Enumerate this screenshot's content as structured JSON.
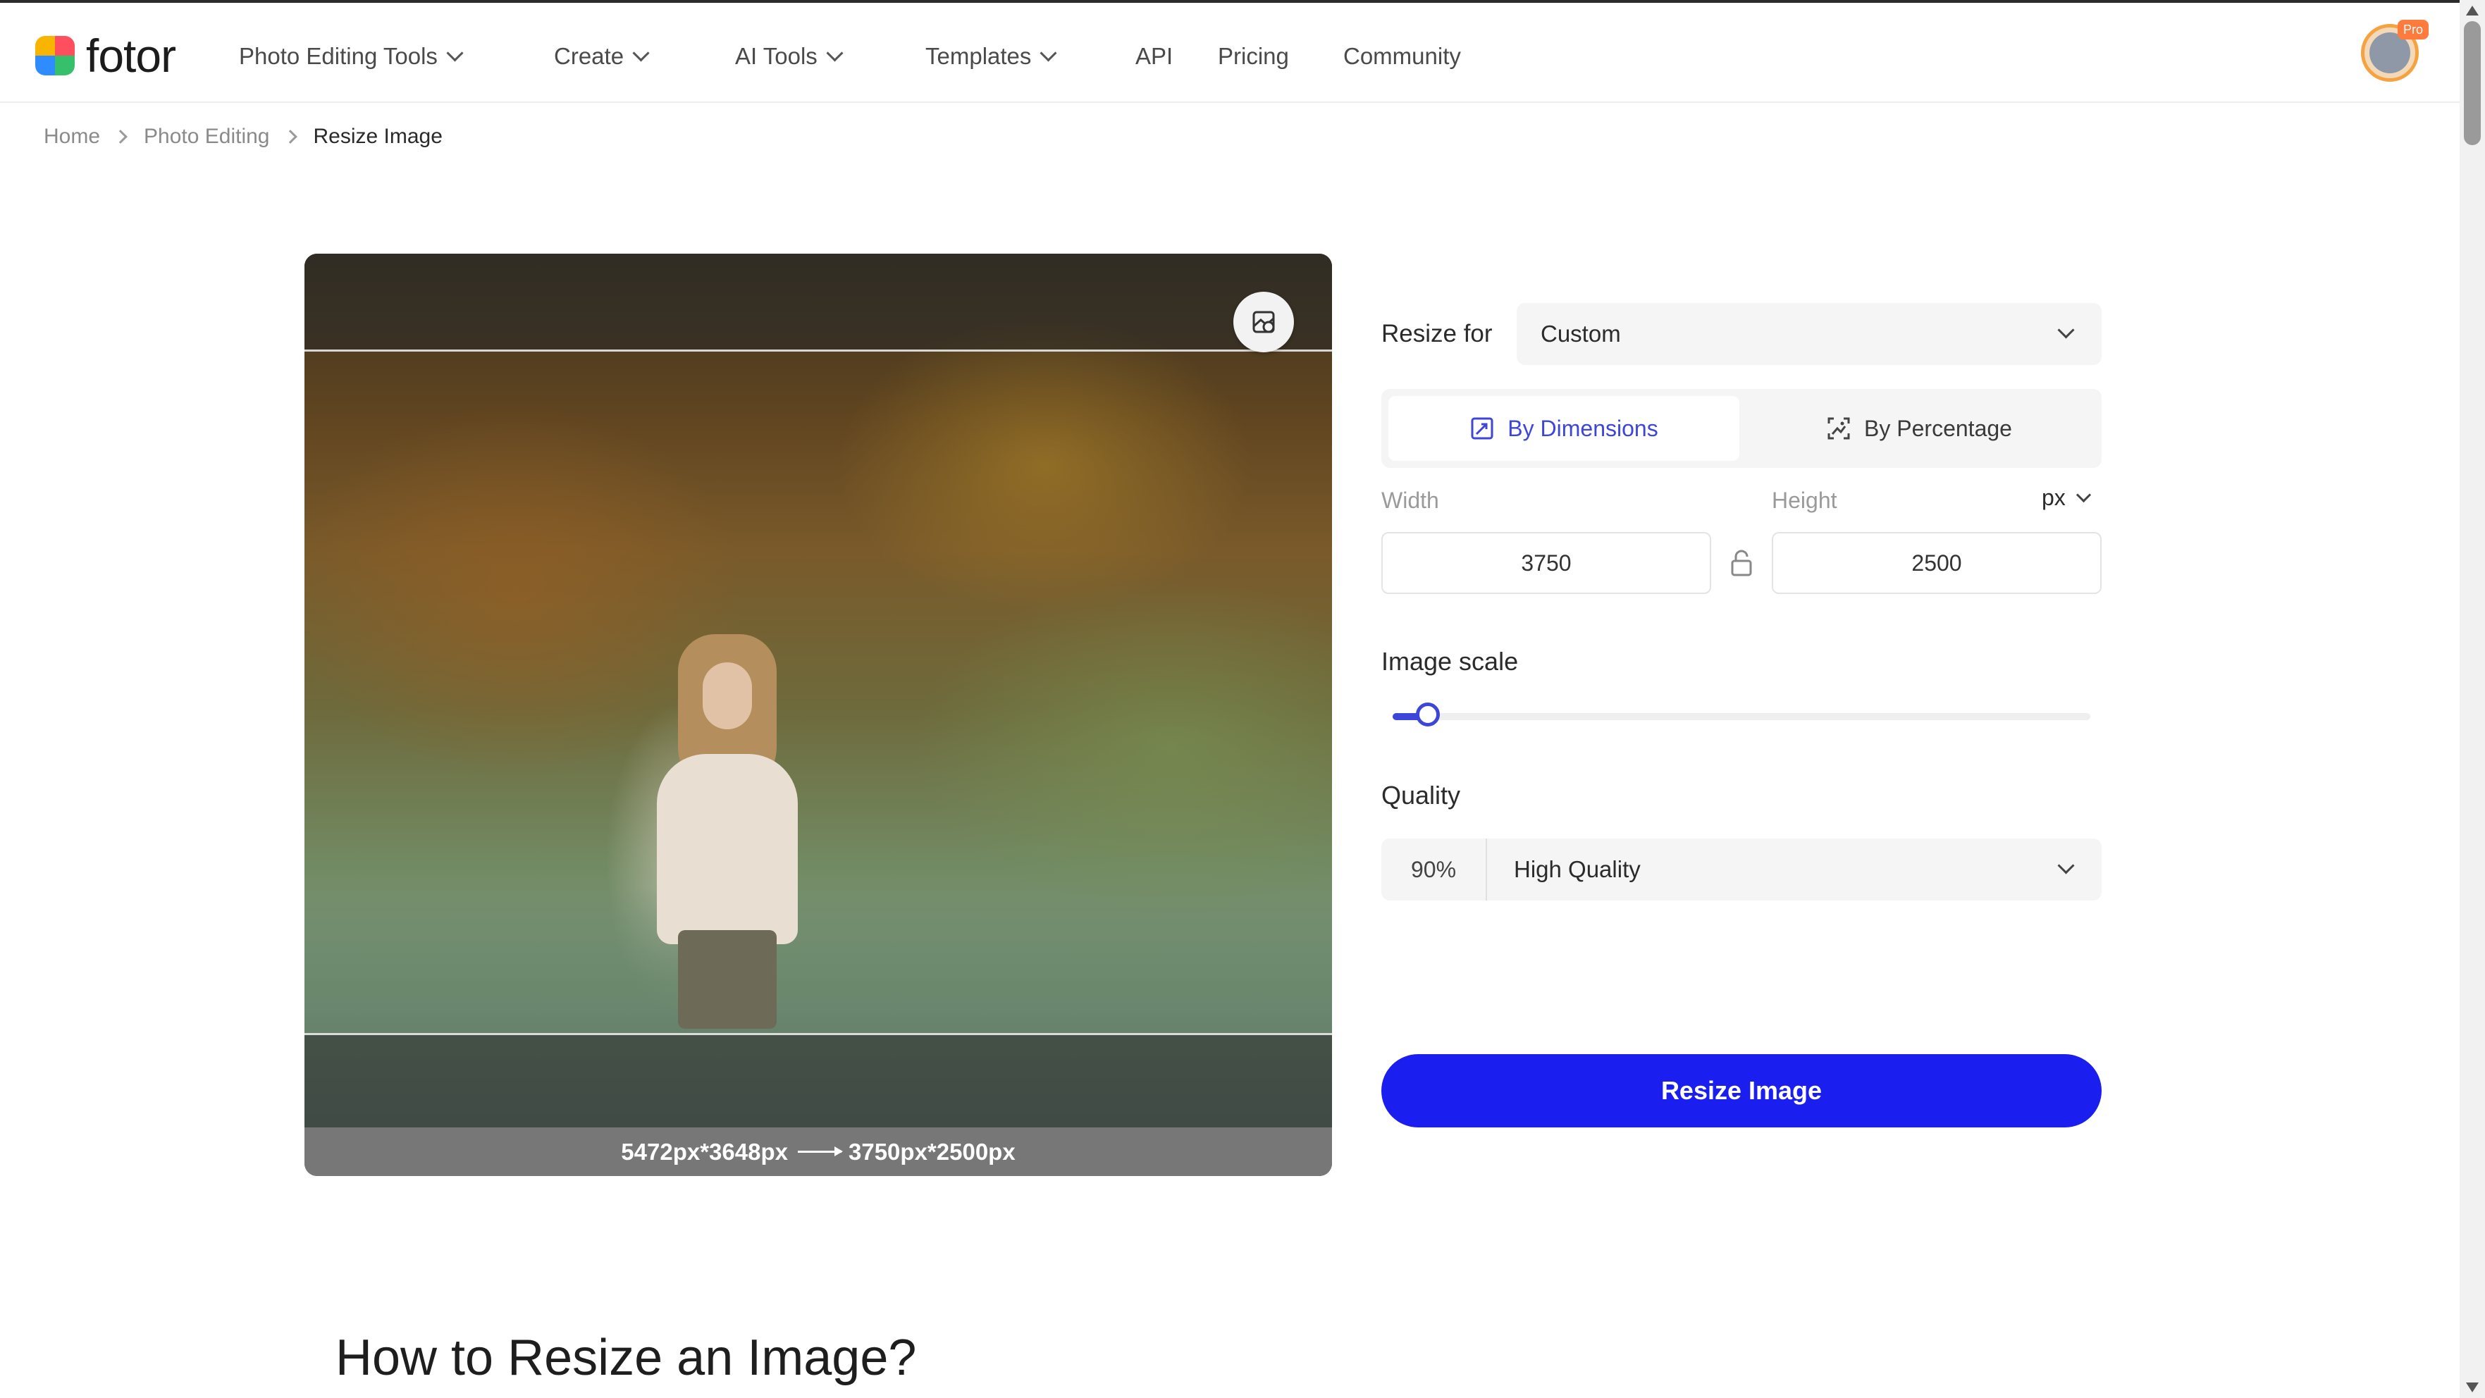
{
  "header": {
    "logo_text": "fotor",
    "nav": [
      {
        "label": "Photo Editing Tools",
        "dropdown": true
      },
      {
        "label": "Create",
        "dropdown": true
      },
      {
        "label": "AI Tools",
        "dropdown": true
      },
      {
        "label": "Templates",
        "dropdown": true
      },
      {
        "label": "API",
        "dropdown": false
      },
      {
        "label": "Pricing",
        "dropdown": false
      },
      {
        "label": "Community",
        "dropdown": false
      }
    ],
    "badge": "Pro"
  },
  "breadcrumb": [
    "Home",
    "Photo Editing",
    "Resize Image"
  ],
  "preview": {
    "original_size": "5472px*3648px",
    "new_size": "3750px*2500px"
  },
  "panel": {
    "resize_for_label": "Resize for",
    "resize_for_value": "Custom",
    "tabs": [
      "By Dimensions",
      "By Percentage"
    ],
    "active_tab": "By Dimensions",
    "width_label": "Width",
    "height_label": "Height",
    "unit": "px",
    "width_value": "3750",
    "height_value": "2500",
    "scale_title": "Image scale",
    "scale_fraction": 0.05,
    "quality_title": "Quality",
    "quality_percent": "90%",
    "quality_value": "High Quality",
    "resize_button": "Resize Image"
  },
  "howto_title": "How to Resize an Image?",
  "colors": {
    "accent": "#3d46d8",
    "button": "#1a1ff0",
    "avatar_ring": "#f4a340"
  }
}
